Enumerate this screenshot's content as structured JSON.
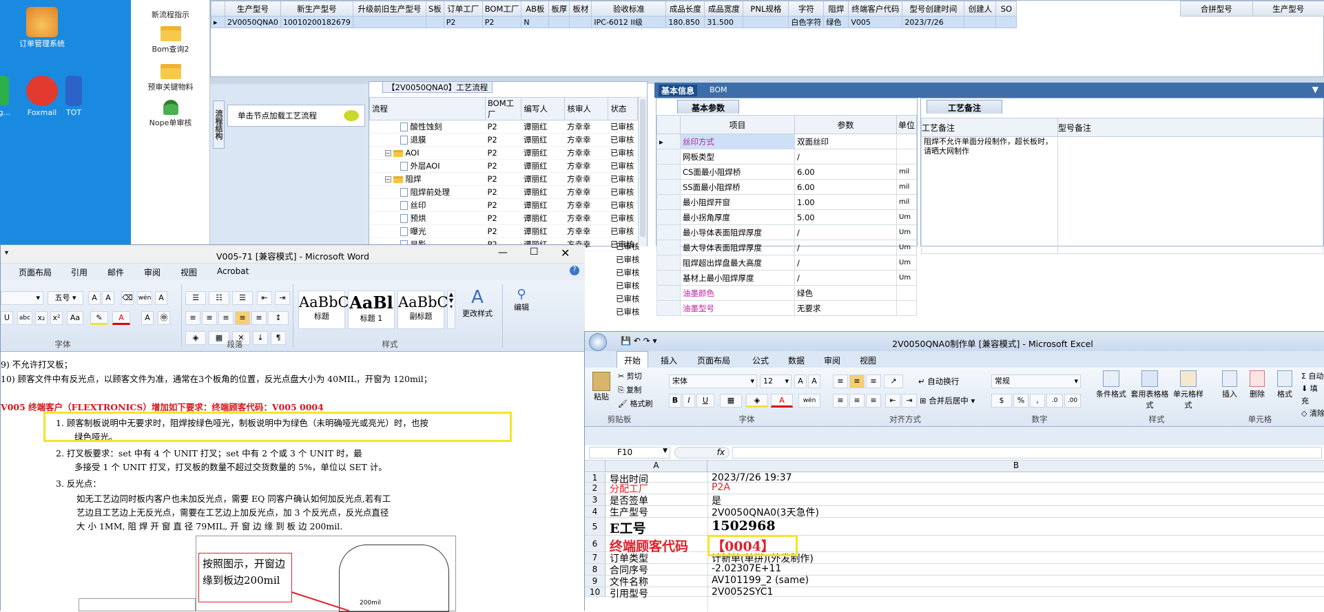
{
  "desktop": {
    "icons": [
      {
        "label": "订单管理系统",
        "name": "order-mgmt"
      },
      {
        "label": "Foxmail",
        "name": "foxmail"
      },
      {
        "label": "TOT",
        "name": "tot"
      },
      {
        "label": "eg...",
        "name": "eg"
      }
    ]
  },
  "sidebar": {
    "items": [
      {
        "label": "新流程指示"
      },
      {
        "label": "Bom查询2"
      },
      {
        "label": "预审关键物料"
      },
      {
        "label": "Nope单审核"
      }
    ]
  },
  "top_grid": {
    "headers": [
      "生产型号",
      "新生产型号",
      "升级前旧生产型号",
      "S板",
      "订单工厂",
      "BOM工厂",
      "AB板",
      "板厚",
      "板材",
      "验收标准",
      "成品长度",
      "成品宽度",
      "PNL规格",
      "字符",
      "阻焊",
      "终端客户代码",
      "型号创建时间",
      "创建人",
      "SO"
    ],
    "row": [
      "2V0050QNA0",
      "10010200182679",
      "",
      "",
      "P2",
      "P2",
      "N",
      "",
      "",
      "IPC-6012 II级",
      "180.850",
      "31.500",
      "",
      "白色字符",
      "绿色",
      "V005",
      "2023/7/26",
      "",
      ""
    ],
    "right_headers": [
      "合拼型号",
      "生产型号"
    ]
  },
  "side_panel": {
    "vtab": "流程结构",
    "hint": "单击节点加载工艺流程"
  },
  "process": {
    "title": "【2V0050QNA0】工艺流程",
    "headers": [
      "流程",
      "BOM工厂",
      "编写人",
      "核审人",
      "状态"
    ],
    "rows": [
      {
        "name": "酸性蚀刻",
        "level": 2,
        "folder": false,
        "factory": "P2",
        "writer": "谭丽红",
        "checker": "方幸幸",
        "status": "已审核"
      },
      {
        "name": "退膜",
        "level": 2,
        "folder": false,
        "factory": "P2",
        "writer": "谭丽红",
        "checker": "方幸幸",
        "status": "已审核"
      },
      {
        "name": "AOI",
        "level": 1,
        "folder": true,
        "factory": "P2",
        "writer": "谭丽红",
        "checker": "方幸幸",
        "status": "已审核"
      },
      {
        "name": "外层AOI",
        "level": 2,
        "folder": false,
        "factory": "P2",
        "writer": "谭丽红",
        "checker": "方幸幸",
        "status": "已审核"
      },
      {
        "name": "阻焊",
        "level": 1,
        "folder": true,
        "factory": "P2",
        "writer": "谭丽红",
        "checker": "方幸幸",
        "status": "已审核"
      },
      {
        "name": "阻焊前处理",
        "level": 2,
        "folder": false,
        "factory": "P2",
        "writer": "谭丽红",
        "checker": "方幸幸",
        "status": "已审核"
      },
      {
        "name": "丝印",
        "level": 2,
        "folder": false,
        "factory": "P2",
        "writer": "谭丽红",
        "checker": "方幸幸",
        "status": "已审核"
      },
      {
        "name": "预烘",
        "level": 2,
        "folder": false,
        "factory": "P2",
        "writer": "谭丽红",
        "checker": "方幸幸",
        "status": "已审核"
      },
      {
        "name": "曝光",
        "level": 2,
        "folder": false,
        "factory": "P2",
        "writer": "谭丽红",
        "checker": "方幸幸",
        "status": "已审核"
      },
      {
        "name": "显影",
        "level": 2,
        "folder": false,
        "factory": "P2",
        "writer": "谭丽红",
        "checker": "方幸幸",
        "status": "已审核"
      }
    ],
    "extra_status": [
      "已审核",
      "已审核",
      "已审核",
      "已审核",
      "已审核",
      "已审核"
    ]
  },
  "info": {
    "tabs": [
      "基本信息",
      "BOM"
    ],
    "params_tab": "基本参数",
    "params_headers": [
      "项目",
      "参数",
      "单位"
    ],
    "params": [
      {
        "item": "丝印方式",
        "value": "双面丝印",
        "unit": "",
        "pink": true
      },
      {
        "item": "网板类型",
        "value": "/",
        "unit": "",
        "pink": false
      },
      {
        "item": "CS面最小阻焊桥",
        "value": "6.00",
        "unit": "mil",
        "pink": false
      },
      {
        "item": "SS面最小阻焊桥",
        "value": "6.00",
        "unit": "mil",
        "pink": false
      },
      {
        "item": "最小阻焊开窗",
        "value": "1.00",
        "unit": "mil",
        "pink": false
      },
      {
        "item": "最小拐角厚度",
        "value": "5.00",
        "unit": "Um",
        "pink": false
      },
      {
        "item": "最小导体表面阻焊厚度",
        "value": "/",
        "unit": "Um",
        "pink": false
      },
      {
        "item": "最大导体表面阻焊厚度",
        "value": "/",
        "unit": "Um",
        "pink": false
      },
      {
        "item": "阻焊超出焊盘最大高度",
        "value": "/",
        "unit": "Um",
        "pink": false
      },
      {
        "item": "基材上最小阻焊厚度",
        "value": "/",
        "unit": "Um",
        "pink": false
      },
      {
        "item": "油墨颜色",
        "value": "绿色",
        "unit": "",
        "pink": true
      },
      {
        "item": "油墨型号",
        "value": "无要求",
        "unit": "",
        "pink": true
      }
    ],
    "remark_tab": "工艺备注",
    "remark_headers": [
      "工艺备注",
      "型号备注"
    ],
    "remark_text": "阻焊不允许单面分段制作，超长板时，请晒大网制作"
  },
  "word": {
    "title": "V005-71 [兼容模式] - Microsoft Word",
    "tabs": [
      "页面布局",
      "引用",
      "邮件",
      "审阅",
      "视图",
      "Acrobat"
    ],
    "font_size": "五号",
    "groups": [
      "字体",
      "段落",
      "样式",
      "编辑"
    ],
    "styles": [
      {
        "preview": "AaBbC",
        "name": "标题"
      },
      {
        "preview": "AaBl",
        "name": "标题 1"
      },
      {
        "preview": "AaBbC",
        "name": "副标题"
      }
    ],
    "change_styles": "更改样式",
    "lines": {
      "l9": "9) 不允许打叉板；",
      "l10": "10) 顾客文件中有反光点，以顾客文件为准，通常在3个板角的位置，反光点盘大小为 40MIL，开窗为 120mil；",
      "req": "V005 终端客户（FLEXTRONICS）增加如下要求：终端顾客代码：V005 0004",
      "i1a": "1.   顾客制板说明中无要求时，阻焊按绿色哑光，制板说明中为绿色（未明确哑光或亮光）时，也按",
      "i1b": "绿色哑光。",
      "i2a": "2.   打叉板要求：set 中有 4 个 UNIT 打叉；set 中有 2 个或 3 个 UNIT 时，最",
      "i2b": "多接受 1 个 UNIT 打叉，打叉板的数量不超过交货数量的 5%，单位以 SET 计。",
      "i3": "3.   反光点：",
      "i3a": "如无工艺边同时板内客户也未加反光点，需要 EQ 同客户确认如何加反光点,若有工",
      "i3b": "艺边且工艺边上无反光点，需要在工艺边上加反光点，加 3 个反光点，反光点直径",
      "i3c": "大 小  1MM, 阻 焊 开 窗 直 径  79MIL, 开 窗 边 缘 到 板 边  200mil.",
      "note": "按照图示，开窗边缘到板边200mil",
      "fig": "200mil"
    }
  },
  "excel": {
    "title": "2V0050QNA0制作单 [兼容模式] - Microsoft Excel",
    "tabs": [
      "开始",
      "插入",
      "页面布局",
      "公式",
      "数据",
      "审阅",
      "视图"
    ],
    "font": "宋体",
    "font_size": "12",
    "number_format": "常规",
    "cell_ref": "F10",
    "clip": [
      "剪切",
      "复制",
      "格式刷"
    ],
    "paste": "粘贴",
    "wrap": "自动换行",
    "merge": "合并后居中",
    "style_btns": [
      "条件格式",
      "套用表格格式",
      "单元格样式"
    ],
    "cell_btns": [
      "插入",
      "删除",
      "格式"
    ],
    "sum_btns": [
      "自动",
      "填充",
      "清除"
    ],
    "groups": [
      "剪贴板",
      "字体",
      "对齐方式",
      "数字",
      "样式",
      "单元格"
    ],
    "cols": [
      "A",
      "B"
    ],
    "rows": [
      {
        "n": "1",
        "a": "导出时间",
        "b": "2023/7/26 19:37",
        "big": false,
        "red": false
      },
      {
        "n": "2",
        "a": "分配工厂",
        "b": "P2A",
        "big": false,
        "red": true
      },
      {
        "n": "3",
        "a": "是否签单",
        "b": "是",
        "big": false,
        "red": false
      },
      {
        "n": "4",
        "a": "生产型号",
        "b": "2V0050QNA0(3天急件)",
        "big": false,
        "red": false
      },
      {
        "n": "5",
        "a": "E工号",
        "b": "1502968",
        "big": true,
        "red": false
      },
      {
        "n": "6",
        "a": "终端顾客代码",
        "b": "【0004】",
        "big": true,
        "red": true
      },
      {
        "n": "7",
        "a": "订单类型",
        "b": "计新单(单拼)(外发制作)",
        "big": false,
        "red": false
      },
      {
        "n": "8",
        "a": "合同序号",
        "b": "-2.02307E+11",
        "big": false,
        "red": false
      },
      {
        "n": "9",
        "a": "文件名称",
        "b": "AV101199_2 (same)",
        "big": false,
        "red": false
      },
      {
        "n": "10",
        "a": "引用型号",
        "b": "2V0052SYC1",
        "big": false,
        "red": false
      }
    ]
  }
}
